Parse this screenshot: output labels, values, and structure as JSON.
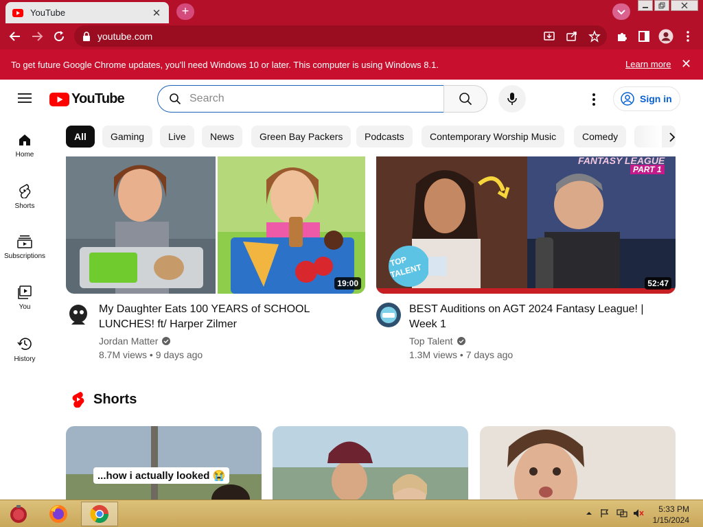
{
  "browser": {
    "tab_title": "YouTube",
    "tab_close": "✕",
    "new_tab": "+",
    "url": "youtube.com",
    "infobar_text": "To get future Google Chrome updates, you'll need Windows 10 or later. This computer is using Windows 8.1.",
    "infobar_link": "Learn more",
    "infobar_close": "✕"
  },
  "header": {
    "logo_text": "YouTube",
    "search_placeholder": "Search",
    "signin_label": "Sign in"
  },
  "sidebar": {
    "items": [
      {
        "label": "Home",
        "icon": "home-icon"
      },
      {
        "label": "Shorts",
        "icon": "shorts-icon"
      },
      {
        "label": "Subscriptions",
        "icon": "subscriptions-icon"
      },
      {
        "label": "You",
        "icon": "you-icon"
      },
      {
        "label": "History",
        "icon": "history-icon"
      }
    ]
  },
  "chips": [
    "All",
    "Gaming",
    "Live",
    "News",
    "Green Bay Packers",
    "Podcasts",
    "Contemporary Worship Music",
    "Comedy"
  ],
  "videos": [
    {
      "title": "My Daughter Eats 100 YEARS of SCHOOL LUNCHES! ft/ Harper Zilmer",
      "channel": "Jordan Matter",
      "meta": "8.7M views • 9 days ago",
      "duration": "19:00"
    },
    {
      "title": "BEST Auditions on AGT 2024 Fantasy League! | Week 1",
      "channel": "Top Talent",
      "meta": "1.3M views • 7 days ago",
      "duration": "52:47",
      "thumb_text_1": "FANTASY LEAGUE",
      "thumb_text_2": "PART 1",
      "thumb_badge_1": "TOP",
      "thumb_badge_2": "TALENT"
    }
  ],
  "shorts": {
    "heading": "Shorts",
    "items": [
      {
        "caption": "...how i actually looked 😭"
      },
      {
        "caption": ""
      },
      {
        "caption": ""
      }
    ]
  },
  "taskbar": {
    "time": "5:33 PM",
    "date": "1/15/2024"
  },
  "colors": {
    "chrome_red": "#b5102a",
    "infobar_red": "#c8102e",
    "youtube_red": "#ff0000",
    "link_blue": "#065fd4"
  }
}
